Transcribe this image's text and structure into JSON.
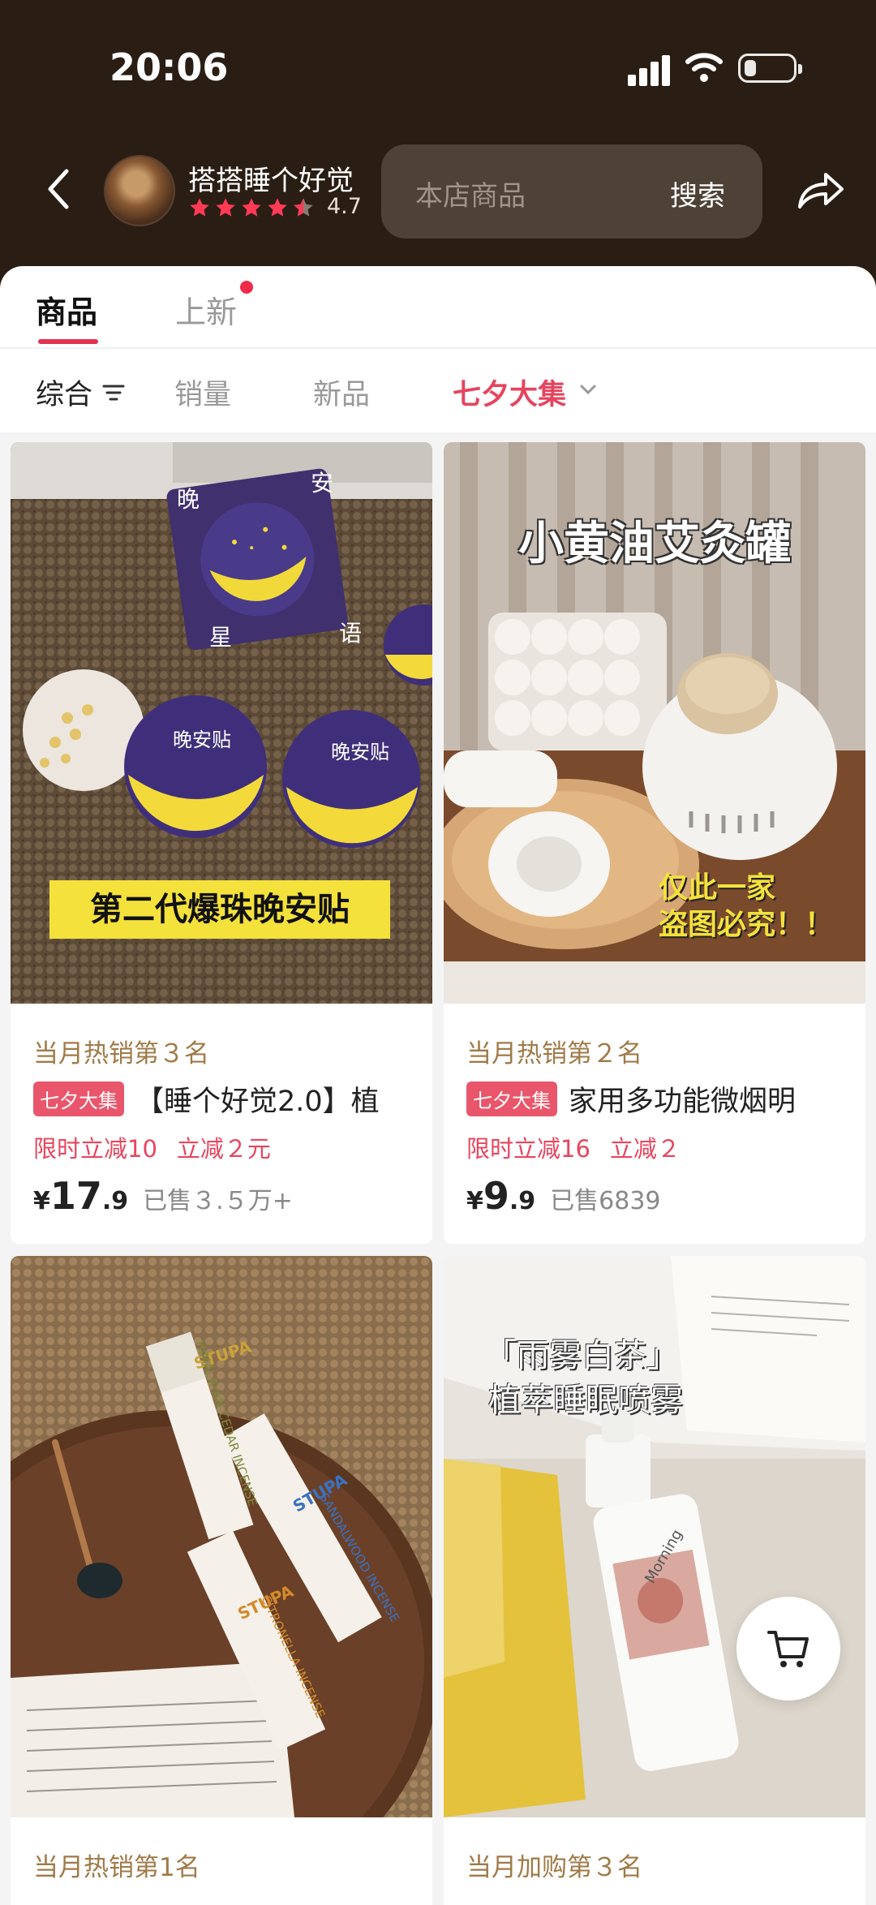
{
  "status_bar": {
    "time": "20:06"
  },
  "header": {
    "store_name": "搭搭睡个好觉",
    "rating": "4.7",
    "search_placeholder": "本店商品",
    "search_button": "搜索"
  },
  "tabs": {
    "goods": "商品",
    "new": "上新"
  },
  "sort": {
    "all": "综合",
    "sales": "销量",
    "new": "新品",
    "festival": "七夕大集"
  },
  "products": [
    {
      "image_text": "第二代爆珠晚安贴",
      "rank": "当月热销第３名",
      "tag": "七夕大集",
      "title": "【睡个好觉2.0】植",
      "promo1": "限时立减10",
      "promo2": "立减２元",
      "currency": "¥",
      "price_int": "17",
      "price_dec": ".9",
      "sold": "已售３.５万+",
      "sticker_label": "晚安贴",
      "box_chars": [
        "晚",
        "安",
        "星",
        "语"
      ]
    },
    {
      "image_title": "小黄油艾灸罐",
      "image_caption_1": "仅此一家",
      "image_caption_2": "盗图必究！！",
      "rank": "当月热销第２名",
      "tag": "七夕大集",
      "title": "家用多功能微烟明",
      "promo1": "限时立减16",
      "promo2": "立减２",
      "currency": "¥",
      "price_int": "9",
      "price_dec": ".9",
      "sold": "已售6839"
    },
    {
      "box_labels": [
        "STUPA",
        "STUPA",
        "STUPA"
      ],
      "box_names": [
        "HIMALAYAN CEDAR INCENSE",
        "SANDALWOOD INCENSE",
        "CITRONELLA INCENSE"
      ],
      "rank": "当月热销第1名"
    },
    {
      "image_title_1": "「雨雾白茶」",
      "image_title_2": "植萃睡眠喷雾",
      "bottle_label": "Morning",
      "rank": "当月加购第３名"
    }
  ],
  "colors": {
    "header_bg": "#2a1e14",
    "accent": "#e33350",
    "festival": "#e5455f",
    "rank": "#a07a48",
    "star": "#ff3a55"
  },
  "icons": [
    "back-arrow-icon",
    "star-icon",
    "search-icon",
    "share-icon",
    "sort-filter-icon",
    "chevron-down-icon",
    "cart-icon"
  ]
}
